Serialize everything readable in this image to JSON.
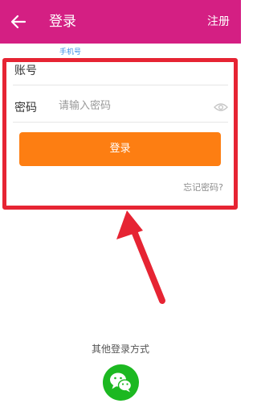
{
  "header": {
    "back_icon": "arrow-left-icon",
    "title": "登录",
    "register_label": "注册",
    "background_color": "#d41f83"
  },
  "form": {
    "phone_hint": "手机号",
    "account_label": "账号",
    "account_value": "",
    "password_label": "密码",
    "password_placeholder": "请输入密码",
    "password_visibility_icon": "eye-icon",
    "login_button_label": "登录",
    "login_button_color": "#fd7e12",
    "forgot_password": "忘记密码?"
  },
  "annotation": {
    "highlight_color": "#e62433"
  },
  "footer": {
    "other_methods_label": "其他登录方式",
    "wechat_icon": "wechat-icon",
    "wechat_color": "#1cb821"
  }
}
